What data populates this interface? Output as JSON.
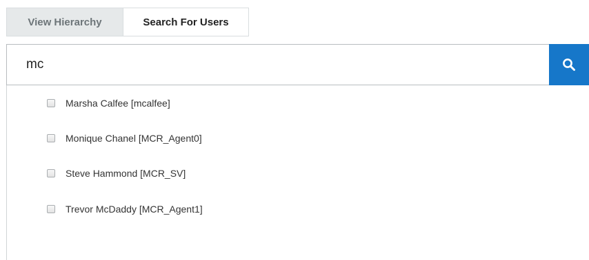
{
  "tabs": [
    {
      "label": "View Hierarchy",
      "active": false
    },
    {
      "label": "Search For Users",
      "active": true
    }
  ],
  "search": {
    "value": "mc",
    "icon": "search-icon",
    "button_color": "#1677c9"
  },
  "results": [
    {
      "label": "Marsha Calfee [mcalfee]",
      "checked": false
    },
    {
      "label": "Monique Chanel [MCR_Agent0]",
      "checked": false
    },
    {
      "label": "Steve Hammond [MCR_SV]",
      "checked": false
    },
    {
      "label": "Trevor McDaddy [MCR_Agent1]",
      "checked": false
    }
  ]
}
